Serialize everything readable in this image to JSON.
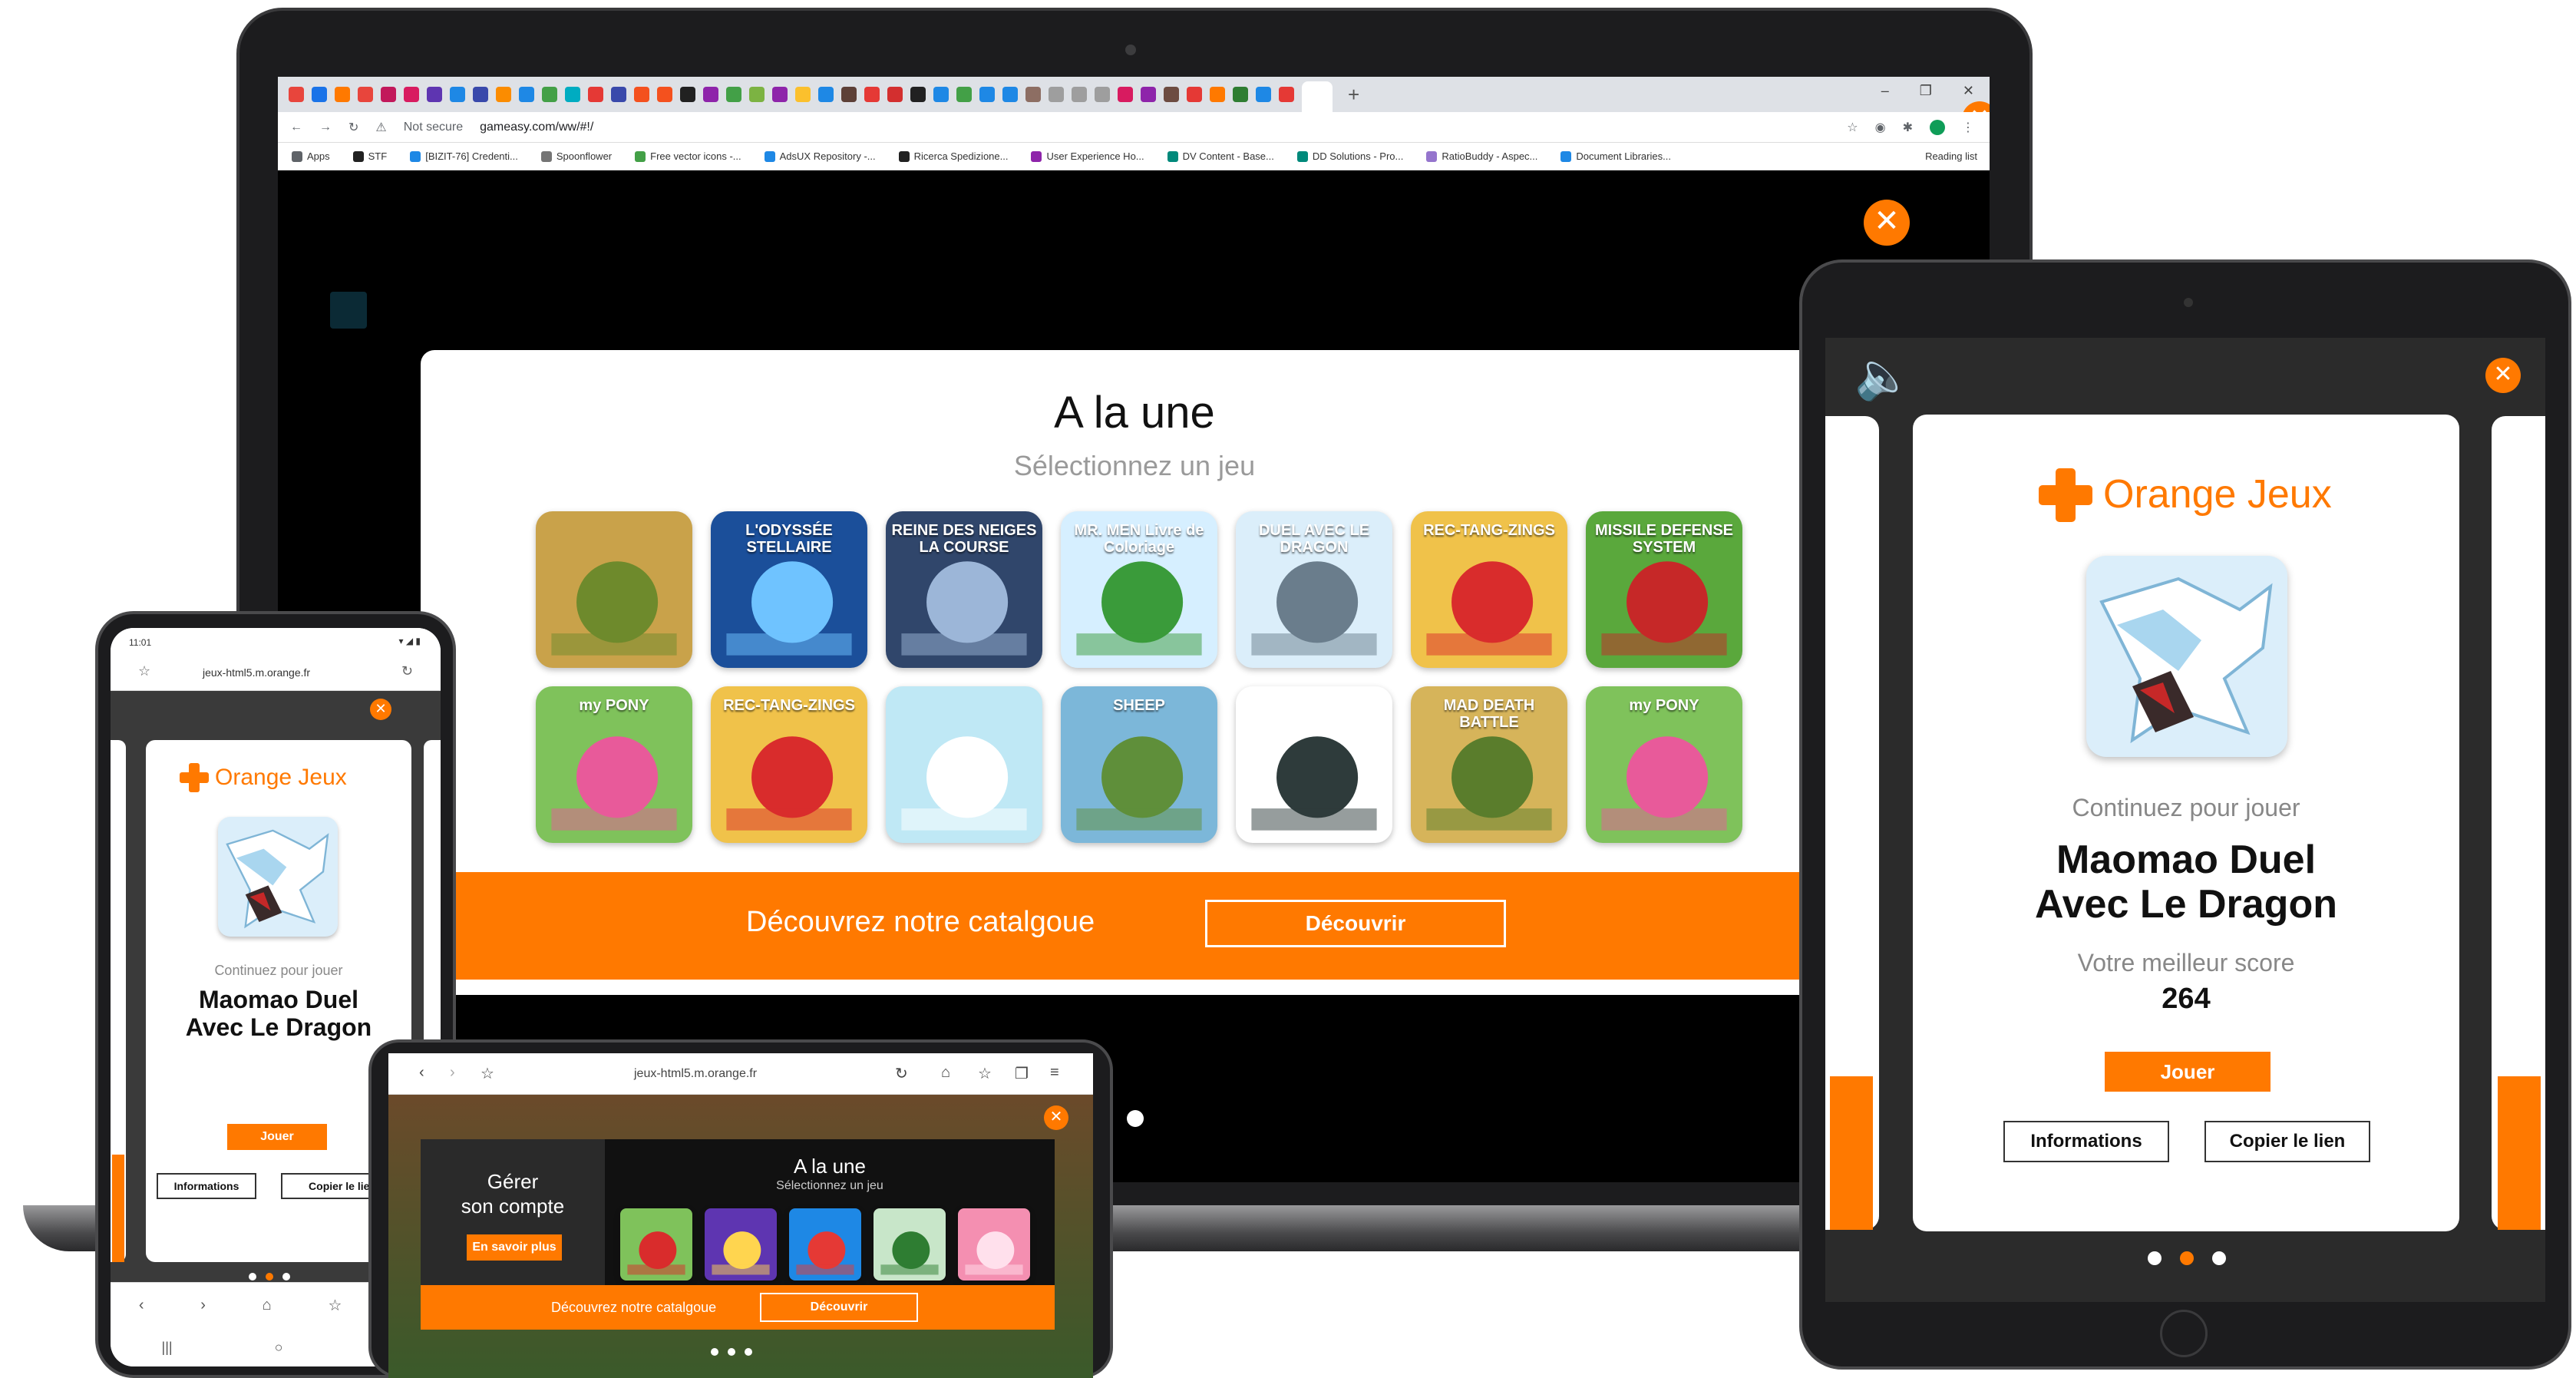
{
  "laptop": {
    "browser": {
      "tab_icons": [
        "#e8453c",
        "#1a73e8",
        "#ff7900",
        "#e8453c",
        "#c2185b",
        "#d81b60",
        "#5e35b1",
        "#1e88e5",
        "#3949ab",
        "#fb8c00",
        "#1e88e5",
        "#43a047",
        "#00acc1",
        "#e53935",
        "#3949ab",
        "#f4511e",
        "#f4511e",
        "#212121",
        "#8e24aa",
        "#43a047",
        "#7cb342",
        "#8e24aa",
        "#fbc02d",
        "#1e88e5",
        "#5d4037",
        "#e53935",
        "#d32f2f",
        "#212121",
        "#1e88e5",
        "#43a047",
        "#1e88e5",
        "#1e88e5",
        "#8d6e63",
        "#9e9e9e",
        "#9e9e9e",
        "#9e9e9e",
        "#d81b60",
        "#8e24aa",
        "#6d4c41",
        "#e53935",
        "#ff7900",
        "#2e7d32",
        "#1e88e5",
        "#e53935"
      ],
      "security": "Not secure",
      "url": "gameasy.com/ww/#!/",
      "bookmarks": [
        {
          "label": "Apps",
          "color": "#5f6368"
        },
        {
          "label": "STF",
          "color": "#212121"
        },
        {
          "label": "[BIZIT-76] Credenti...",
          "color": "#1e88e5"
        },
        {
          "label": "Spoonflower",
          "color": "#757575"
        },
        {
          "label": "Free vector icons -...",
          "color": "#43a047"
        },
        {
          "label": "AdsUX Repository -...",
          "color": "#1e88e5"
        },
        {
          "label": "Ricerca Spedizione...",
          "color": "#212121"
        },
        {
          "label": "User Experience Ho...",
          "color": "#8e24aa"
        },
        {
          "label": "DV Content - Base...",
          "color": "#00897b"
        },
        {
          "label": "DD Solutions - Pro...",
          "color": "#00897b"
        },
        {
          "label": "RatioBuddy - Aspec...",
          "color": "#9575cd"
        },
        {
          "label": "Document Libraries...",
          "color": "#1e88e5"
        }
      ],
      "reading_list": "Reading list"
    },
    "modal": {
      "title": "A la une",
      "subtitle": "Sélectionnez un jeu",
      "banner_text": "Découvrez notre catalgoue",
      "banner_button": "Découvrir",
      "thumbs_row1": [
        {
          "bg": "#c9a24a",
          "fg": "#6e8a2c",
          "label": ""
        },
        {
          "bg": "#1b4f9a",
          "fg": "#6fc3ff",
          "label": "L'ODYSSÉE STELLAIRE"
        },
        {
          "bg": "#30466b",
          "fg": "#9cb6d8",
          "label": "REINE DES NEIGES LA COURSE"
        },
        {
          "bg": "#d6efff",
          "fg": "#3a9b3a",
          "label": "MR. MEN Livre de Coloriage"
        },
        {
          "bg": "#dbeefa",
          "fg": "#6a7d8c",
          "label": "DUEL AVEC LE DRAGON"
        },
        {
          "bg": "#f0c24a",
          "fg": "#d92c2c",
          "label": "REC-TANG-ZINGS"
        },
        {
          "bg": "#5aa83c",
          "fg": "#c62828",
          "label": "MISSILE DEFENSE SYSTEM"
        }
      ],
      "thumbs_row2": [
        {
          "bg": "#7fc25b",
          "fg": "#e85a9a",
          "label": "my PONY"
        },
        {
          "bg": "#f0c24a",
          "fg": "#d92c2c",
          "label": "REC-TANG-ZINGS"
        },
        {
          "bg": "#bfe8f5",
          "fg": "#ffffff",
          "label": ""
        },
        {
          "bg": "#7cb7d9",
          "fg": "#5f8f3a",
          "label": "SHEEP"
        },
        {
          "bg": "#ffffff",
          "fg": "#2e3b3b",
          "label": ""
        },
        {
          "bg": "#d6b45a",
          "fg": "#5a7d2c",
          "label": "MAD DEATH BATTLE"
        },
        {
          "bg": "#7fc25b",
          "fg": "#e85a9a",
          "label": "my PONY"
        }
      ]
    }
  },
  "tablet": {
    "brand": "Orange Jeux",
    "continue_label": "Continuez pour jouer",
    "game_title_line1": "Maomao Duel",
    "game_title_line2": "Avec Le Dragon",
    "best_score_label": "Votre meilleur score",
    "best_score": "264",
    "play_button": "Jouer",
    "info_button": "Informations",
    "copy_link_button": "Copier le lien"
  },
  "phone": {
    "status_time": "11:01",
    "url": "jeux-html5.m.orange.fr",
    "brand": "Orange Jeux",
    "continue_label": "Continuez pour jouer",
    "game_title_line1": "Maomao Duel",
    "game_title_line2": "Avec Le Dragon",
    "play_button": "Jouer",
    "info_button": "Informations",
    "copy_link_button": "Copier le lien"
  },
  "small_tablet": {
    "url": "jeux-html5.m.orange.fr",
    "account_line1": "Gérer",
    "account_line2": "son compte",
    "account_button": "En savoir plus",
    "title": "A la une",
    "subtitle": "Sélectionnez un jeu",
    "banner_text": "Découvrez notre catalgoue",
    "banner_button": "Découvrir",
    "thumbs": [
      {
        "bg": "#7fc25b",
        "fg": "#d92c2c"
      },
      {
        "bg": "#5e35b1",
        "fg": "#ffd54f"
      },
      {
        "bg": "#1e88e5",
        "fg": "#e53935"
      },
      {
        "bg": "#c8e6c9",
        "fg": "#2e7d32"
      },
      {
        "bg": "#f48fb1",
        "fg": "#ffe0ec"
      }
    ]
  }
}
